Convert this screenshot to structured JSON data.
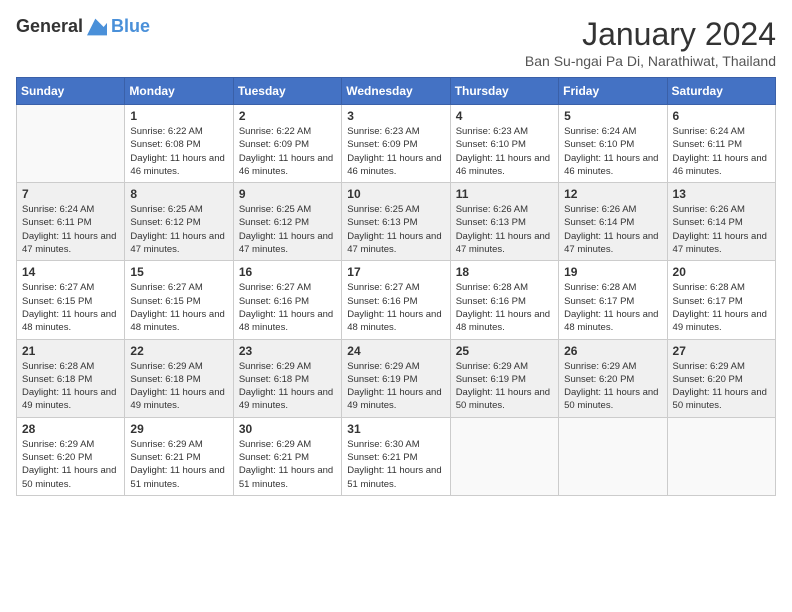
{
  "header": {
    "logo_general": "General",
    "logo_blue": "Blue",
    "month_year": "January 2024",
    "location": "Ban Su-ngai Pa Di, Narathiwat, Thailand"
  },
  "days_of_week": [
    "Sunday",
    "Monday",
    "Tuesday",
    "Wednesday",
    "Thursday",
    "Friday",
    "Saturday"
  ],
  "weeks": [
    [
      {
        "day": "",
        "info": ""
      },
      {
        "day": "1",
        "info": "Sunrise: 6:22 AM\nSunset: 6:08 PM\nDaylight: 11 hours and 46 minutes."
      },
      {
        "day": "2",
        "info": "Sunrise: 6:22 AM\nSunset: 6:09 PM\nDaylight: 11 hours and 46 minutes."
      },
      {
        "day": "3",
        "info": "Sunrise: 6:23 AM\nSunset: 6:09 PM\nDaylight: 11 hours and 46 minutes."
      },
      {
        "day": "4",
        "info": "Sunrise: 6:23 AM\nSunset: 6:10 PM\nDaylight: 11 hours and 46 minutes."
      },
      {
        "day": "5",
        "info": "Sunrise: 6:24 AM\nSunset: 6:10 PM\nDaylight: 11 hours and 46 minutes."
      },
      {
        "day": "6",
        "info": "Sunrise: 6:24 AM\nSunset: 6:11 PM\nDaylight: 11 hours and 46 minutes."
      }
    ],
    [
      {
        "day": "7",
        "info": "Sunrise: 6:24 AM\nSunset: 6:11 PM\nDaylight: 11 hours and 47 minutes."
      },
      {
        "day": "8",
        "info": "Sunrise: 6:25 AM\nSunset: 6:12 PM\nDaylight: 11 hours and 47 minutes."
      },
      {
        "day": "9",
        "info": "Sunrise: 6:25 AM\nSunset: 6:12 PM\nDaylight: 11 hours and 47 minutes."
      },
      {
        "day": "10",
        "info": "Sunrise: 6:25 AM\nSunset: 6:13 PM\nDaylight: 11 hours and 47 minutes."
      },
      {
        "day": "11",
        "info": "Sunrise: 6:26 AM\nSunset: 6:13 PM\nDaylight: 11 hours and 47 minutes."
      },
      {
        "day": "12",
        "info": "Sunrise: 6:26 AM\nSunset: 6:14 PM\nDaylight: 11 hours and 47 minutes."
      },
      {
        "day": "13",
        "info": "Sunrise: 6:26 AM\nSunset: 6:14 PM\nDaylight: 11 hours and 47 minutes."
      }
    ],
    [
      {
        "day": "14",
        "info": "Sunrise: 6:27 AM\nSunset: 6:15 PM\nDaylight: 11 hours and 48 minutes."
      },
      {
        "day": "15",
        "info": "Sunrise: 6:27 AM\nSunset: 6:15 PM\nDaylight: 11 hours and 48 minutes."
      },
      {
        "day": "16",
        "info": "Sunrise: 6:27 AM\nSunset: 6:16 PM\nDaylight: 11 hours and 48 minutes."
      },
      {
        "day": "17",
        "info": "Sunrise: 6:27 AM\nSunset: 6:16 PM\nDaylight: 11 hours and 48 minutes."
      },
      {
        "day": "18",
        "info": "Sunrise: 6:28 AM\nSunset: 6:16 PM\nDaylight: 11 hours and 48 minutes."
      },
      {
        "day": "19",
        "info": "Sunrise: 6:28 AM\nSunset: 6:17 PM\nDaylight: 11 hours and 48 minutes."
      },
      {
        "day": "20",
        "info": "Sunrise: 6:28 AM\nSunset: 6:17 PM\nDaylight: 11 hours and 49 minutes."
      }
    ],
    [
      {
        "day": "21",
        "info": "Sunrise: 6:28 AM\nSunset: 6:18 PM\nDaylight: 11 hours and 49 minutes."
      },
      {
        "day": "22",
        "info": "Sunrise: 6:29 AM\nSunset: 6:18 PM\nDaylight: 11 hours and 49 minutes."
      },
      {
        "day": "23",
        "info": "Sunrise: 6:29 AM\nSunset: 6:18 PM\nDaylight: 11 hours and 49 minutes."
      },
      {
        "day": "24",
        "info": "Sunrise: 6:29 AM\nSunset: 6:19 PM\nDaylight: 11 hours and 49 minutes."
      },
      {
        "day": "25",
        "info": "Sunrise: 6:29 AM\nSunset: 6:19 PM\nDaylight: 11 hours and 50 minutes."
      },
      {
        "day": "26",
        "info": "Sunrise: 6:29 AM\nSunset: 6:20 PM\nDaylight: 11 hours and 50 minutes."
      },
      {
        "day": "27",
        "info": "Sunrise: 6:29 AM\nSunset: 6:20 PM\nDaylight: 11 hours and 50 minutes."
      }
    ],
    [
      {
        "day": "28",
        "info": "Sunrise: 6:29 AM\nSunset: 6:20 PM\nDaylight: 11 hours and 50 minutes."
      },
      {
        "day": "29",
        "info": "Sunrise: 6:29 AM\nSunset: 6:21 PM\nDaylight: 11 hours and 51 minutes."
      },
      {
        "day": "30",
        "info": "Sunrise: 6:29 AM\nSunset: 6:21 PM\nDaylight: 11 hours and 51 minutes."
      },
      {
        "day": "31",
        "info": "Sunrise: 6:30 AM\nSunset: 6:21 PM\nDaylight: 11 hours and 51 minutes."
      },
      {
        "day": "",
        "info": ""
      },
      {
        "day": "",
        "info": ""
      },
      {
        "day": "",
        "info": ""
      }
    ]
  ]
}
